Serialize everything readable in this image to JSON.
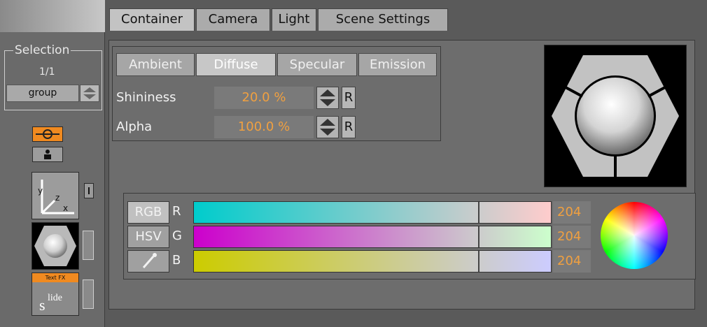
{
  "tabs": [
    "Container",
    "Camera",
    "Light",
    "Scene Settings"
  ],
  "selection": {
    "title": "Selection",
    "count": "1/1",
    "group_label": "group"
  },
  "sidebar": {
    "textfx_label": "Text FX",
    "icons": [
      "container-icon",
      "camera-person-icon",
      "axis-icon",
      "material-sphere-icon",
      "slide-icon"
    ]
  },
  "material": {
    "tabs": [
      "Ambient",
      "Diffuse",
      "Specular",
      "Emission"
    ],
    "active_tab": "Diffuse",
    "shininess_label": "Shininess",
    "shininess_value": "20.0 %",
    "alpha_label": "Alpha",
    "alpha_value": "100.0 %",
    "reset_label": "R"
  },
  "color": {
    "modes": [
      "RGB",
      "HSV"
    ],
    "channels": [
      {
        "label": "R",
        "value": "204",
        "gradient_start": "#00cccc",
        "gradient_end": "#ffcccc"
      },
      {
        "label": "G",
        "value": "204",
        "gradient_start": "#cc00cc",
        "gradient_end": "#ccffcc"
      },
      {
        "label": "B",
        "value": "204",
        "gradient_start": "#cccc00",
        "gradient_end": "#ccccff"
      }
    ],
    "channel_level": 0.8,
    "accent": "#f0a040"
  },
  "x_axis_label": "x",
  "y_axis_label": "y",
  "z_axis_label": "z"
}
